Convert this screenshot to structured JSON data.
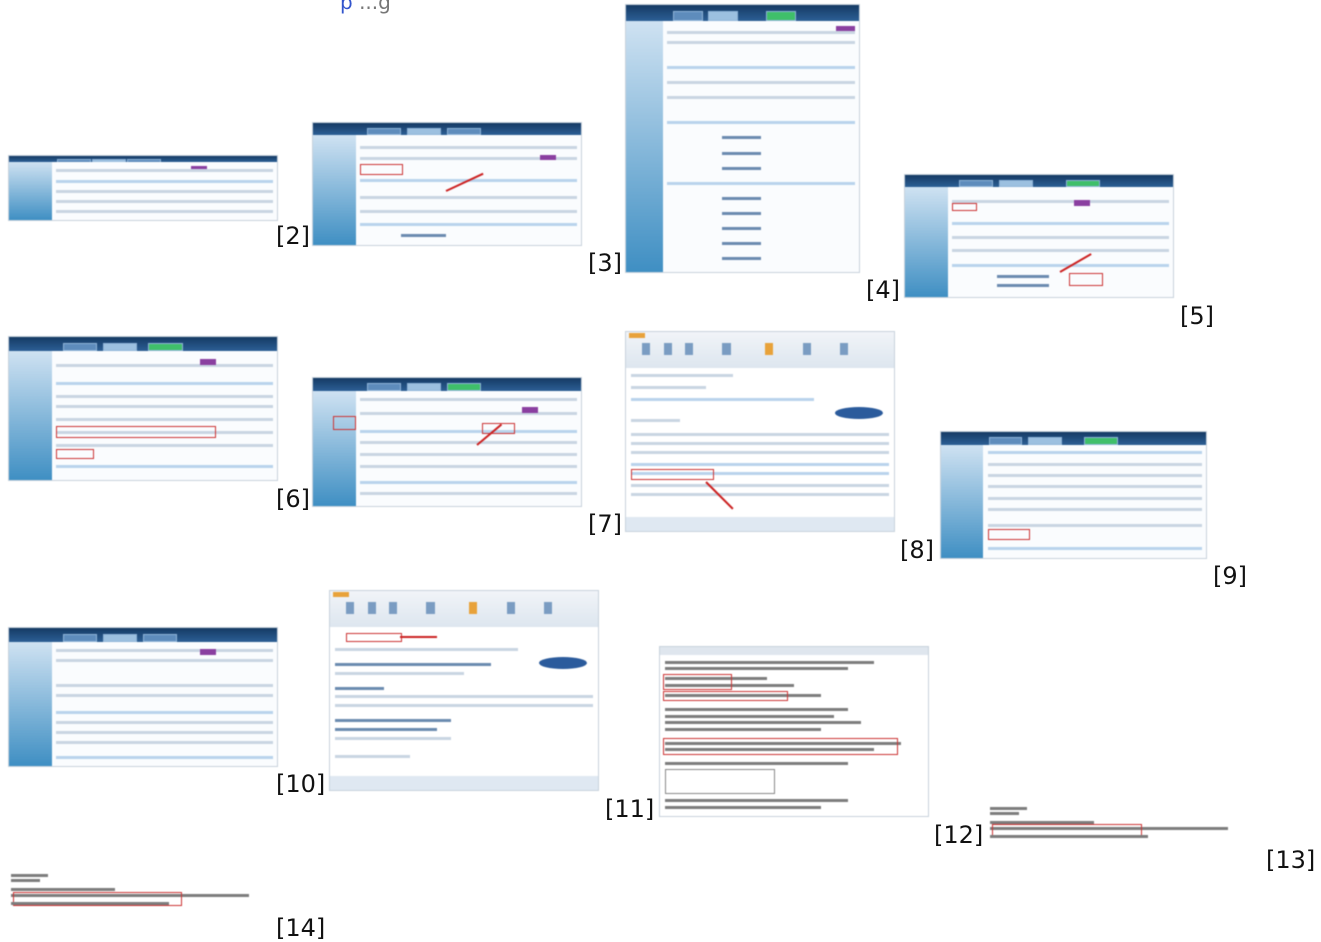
{
  "top_link": {
    "text": "p",
    "rest": "...g"
  },
  "labels": [
    "[2]",
    "[3]",
    "[4]",
    "[5]",
    "[6]",
    "[7]",
    "[8]",
    "[9]",
    "[10]",
    "[11]",
    "[12]",
    "[13]",
    "[14]"
  ]
}
